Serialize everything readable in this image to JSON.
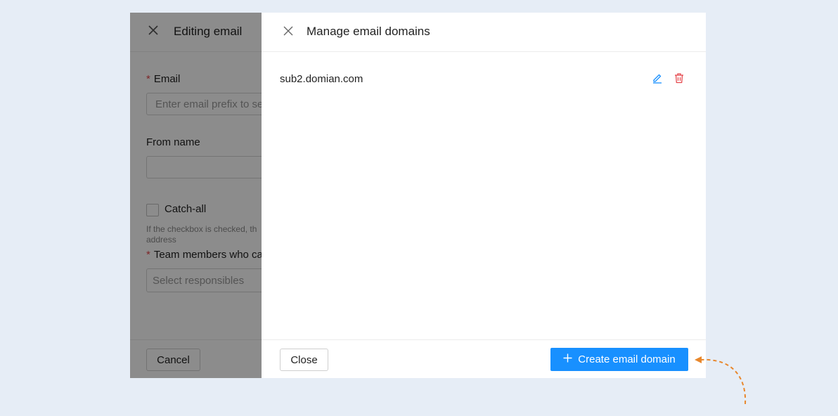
{
  "back_drawer": {
    "title": "Editing email",
    "email_label": "Email",
    "email_placeholder": "Enter email prefix to se",
    "from_name_label": "From name",
    "from_name_value": "",
    "catch_all_label": "Catch-all",
    "catch_all_hint": "If the checkbox is checked, th address",
    "team_members_label": "Team members who ca",
    "team_members_placeholder": "Select responsibles",
    "cancel_label": "Cancel"
  },
  "front_drawer": {
    "title": "Manage email domains",
    "domains": [
      {
        "name": "sub2.domian.com"
      }
    ],
    "close_label": "Close",
    "create_label": "Create email domain"
  },
  "colors": {
    "primary": "#1890ff",
    "danger": "#e5484d",
    "annotation": "#e8872c",
    "background": "#e6edf6"
  }
}
